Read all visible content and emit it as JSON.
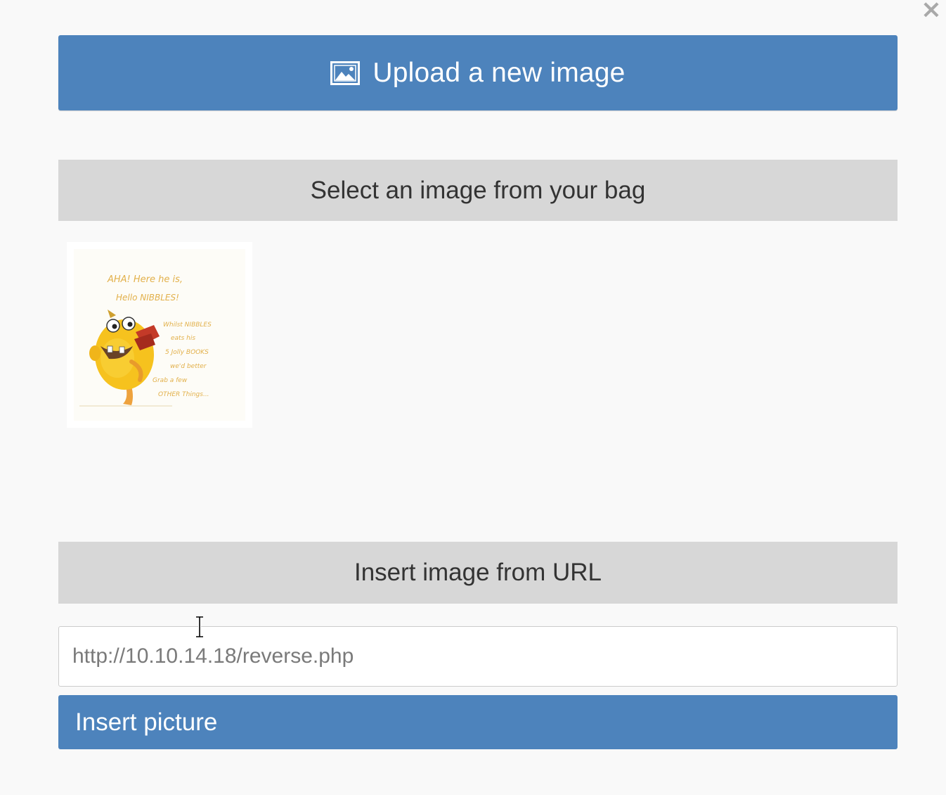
{
  "dialog": {
    "close_glyph": "×"
  },
  "upload": {
    "icon": "image-icon",
    "label": "Upload a new image"
  },
  "bag": {
    "header": "Select an image from your bag",
    "images": [
      {
        "text_lines": [
          "AHA! Here he is,",
          "Hello NIBBLES!",
          "Whilst NIBBLES",
          "eats his",
          "5 Jolly BOOKS",
          "we'd better",
          "Grab a few",
          "OTHER Things..."
        ]
      }
    ]
  },
  "url_section": {
    "header": "Insert image from URL",
    "input_value": "http://10.10.14.18/reverse.php",
    "insert_label": "Insert picture"
  },
  "colors": {
    "primary": "#4d83bc",
    "section_bg": "#d7d7d7",
    "page_bg": "#f9f9f9"
  }
}
